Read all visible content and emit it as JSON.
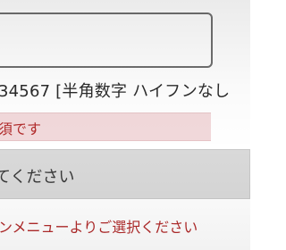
{
  "form": {
    "phone_input_value": "",
    "phone_hint": "34567 [半角数字 ハイフンなし",
    "error_message": "須です",
    "select_placeholder": "てください",
    "select_helper": "ンメニューよりご選択ください"
  }
}
